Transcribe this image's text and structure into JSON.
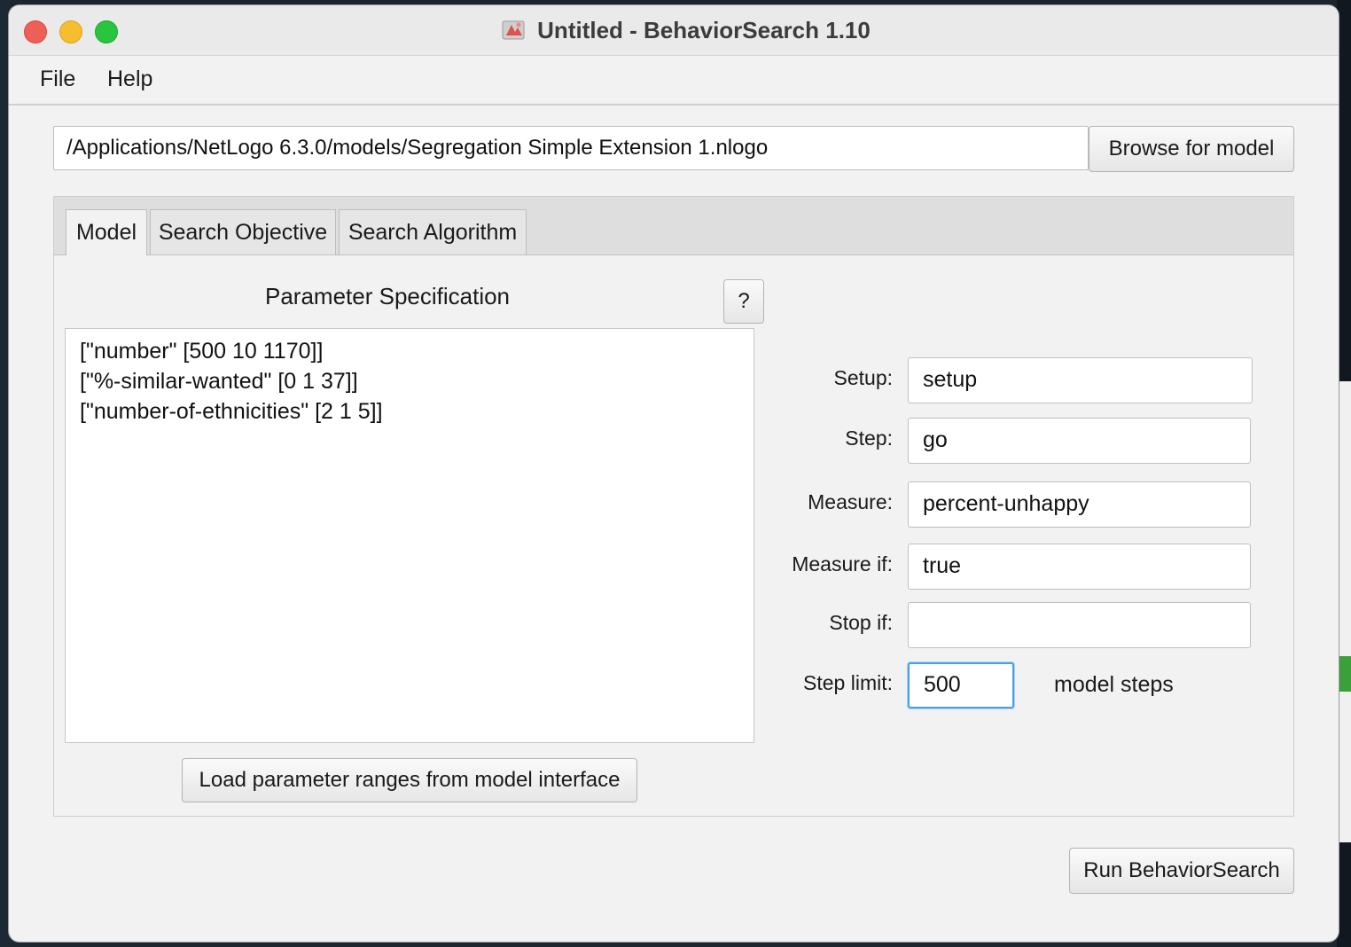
{
  "window": {
    "title": "Untitled - BehaviorSearch 1.10"
  },
  "menu": {
    "items": [
      "File",
      "Help"
    ]
  },
  "model_path": {
    "value": "/Applications/NetLogo 6.3.0/models/Segregation Simple Extension 1.nlogo",
    "browse_label": "Browse for model"
  },
  "tabs": [
    {
      "label": "Model",
      "active": true
    },
    {
      "label": "Search Objective",
      "active": false
    },
    {
      "label": "Search Algorithm",
      "active": false
    }
  ],
  "parameters": {
    "heading": "Parameter Specification",
    "help_label": "?",
    "lines": [
      "[\"number\" [500 10 1170]]",
      "[\"%-similar-wanted\" [0 1 37]]",
      "[\"number-of-ethnicities\" [2 1 5]]"
    ],
    "load_button_label": "Load parameter ranges from model interface"
  },
  "form": {
    "setup": {
      "label": "Setup:",
      "value": "setup"
    },
    "step": {
      "label": "Step:",
      "value": "go"
    },
    "measure": {
      "label": "Measure:",
      "value": "percent-unhappy"
    },
    "measure_if": {
      "label": "Measure if:",
      "value": "true"
    },
    "stop_if": {
      "label": "Stop if:",
      "value": ""
    },
    "step_limit": {
      "label": "Step limit:",
      "value": "500",
      "units": "model steps"
    }
  },
  "run_button_label": "Run BehaviorSearch",
  "colors": {
    "close": "#ee5f57",
    "minimize": "#f6be2f",
    "zoom": "#29c440",
    "focus_ring": "#4a9fe6"
  }
}
